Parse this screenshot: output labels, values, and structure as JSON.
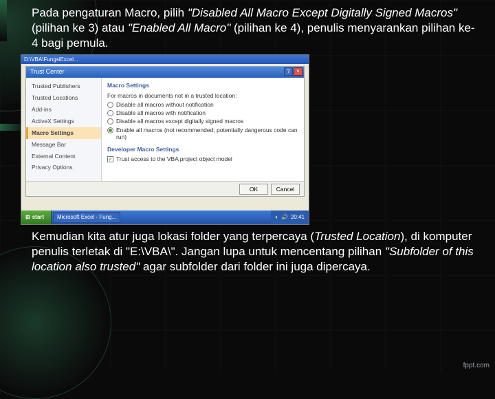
{
  "para1": {
    "a": "Pada pengaturan Macro, pilih ",
    "b": "\"Disabled All Macro Except Digitally Signed Macros\"",
    "c": " (pilihan ke 3) atau ",
    "d": "\"Enabled All Macro\"",
    "e": " (pilihan ke 4), penulis menyarankan pilihan ke-4 bagi pemula."
  },
  "para2": {
    "a": "Kemudian kita atur juga lokasi folder yang terpercaya (",
    "b": "Trusted Location",
    "c": "), di komputer penulis terletak di \"E:\\VBA\\\". Jangan lupa untuk mencentang pilihan ",
    "d": "\"Subfolder of this location also trusted\"",
    "e": " agar subfolder dari folder ini juga dipercaya."
  },
  "shot": {
    "xp_path": "D:\\VBA\\FungsiExcel...",
    "dlg_title": "Trust Center",
    "nav": {
      "items": [
        "Trusted Publishers",
        "Trusted Locations",
        "Add-ins",
        "ActiveX Settings",
        "Macro Settings",
        "Message Bar",
        "External Content",
        "Privacy Options"
      ],
      "selected_index": 4
    },
    "panel": {
      "header1": "Macro Settings",
      "intro": "For macros in documents not in a trusted location:",
      "opts": [
        "Disable all macros without notification",
        "Disable all macros with notification",
        "Disable all macros except digitally signed macros",
        "Enable all macros (not recommended; potentially dangerous code can run)"
      ],
      "selected_opt": 3,
      "header2": "Developer Macro Settings",
      "dev_check": "Trust access to the VBA project object model",
      "dev_checked": true
    },
    "buttons": {
      "ok": "OK",
      "cancel": "Cancel"
    },
    "taskbar": {
      "start": "start",
      "item1": "Microsoft Excel - Fung...",
      "clock": "20:41"
    }
  },
  "credit": "fppt.com"
}
